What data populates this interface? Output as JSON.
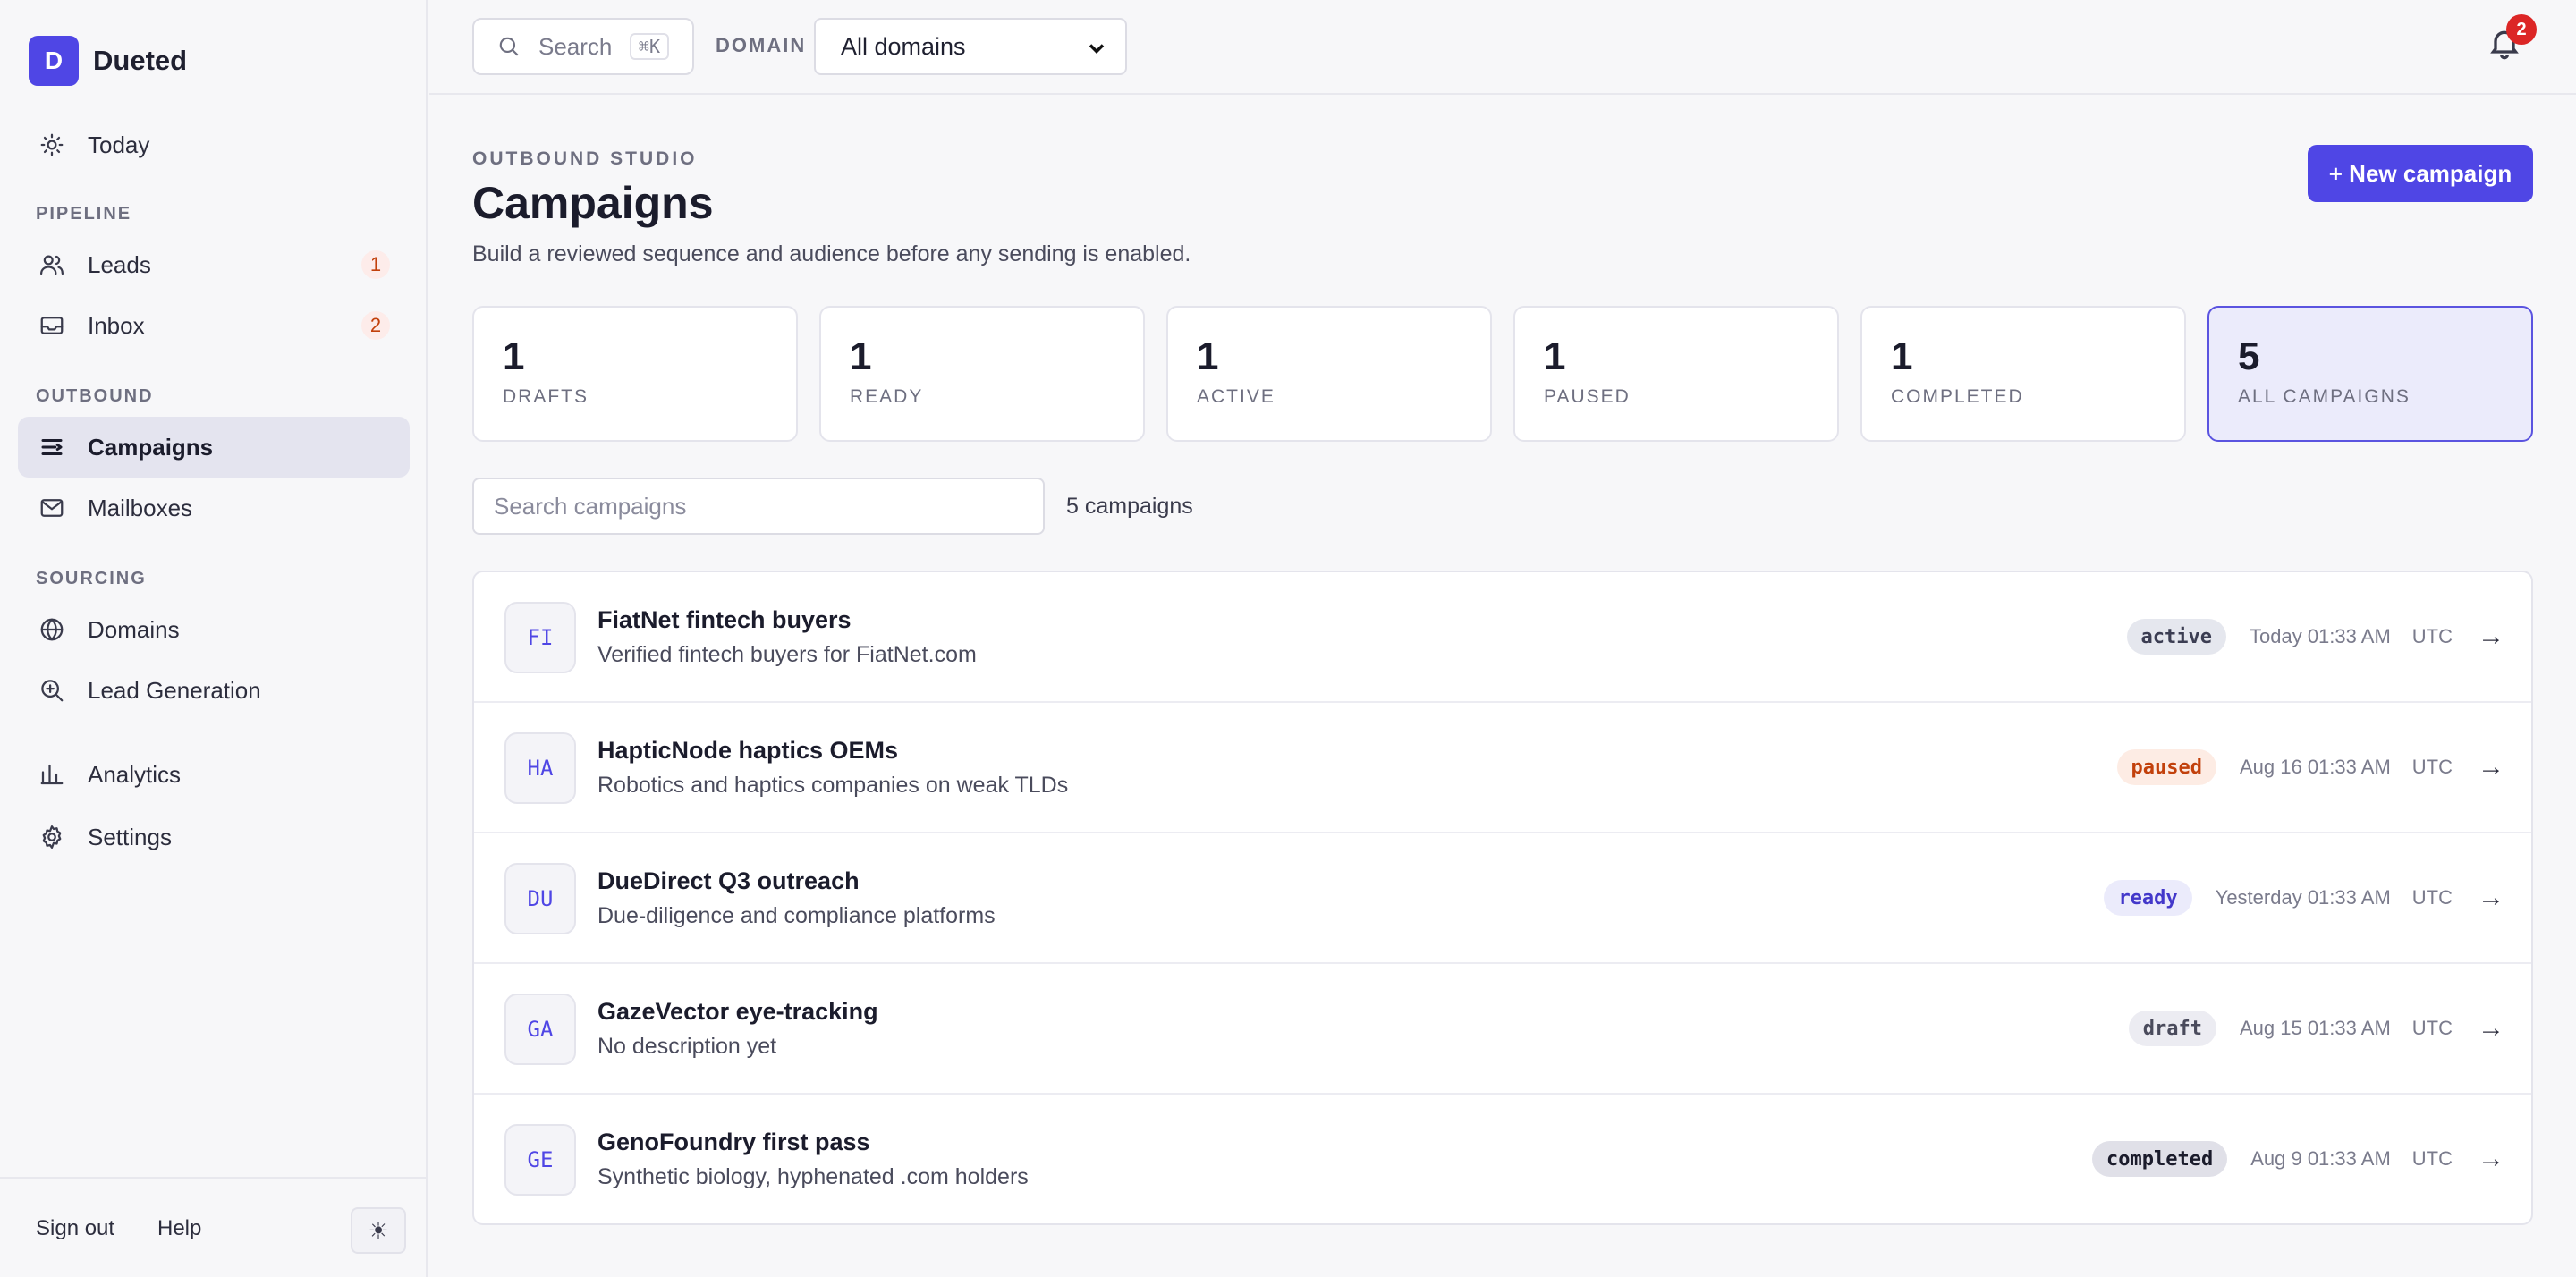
{
  "brand": {
    "initial": "D",
    "name": "Dueted"
  },
  "nav": {
    "today": "Today",
    "pipeline_label": "PIPELINE",
    "leads": {
      "label": "Leads",
      "badge": "1"
    },
    "inbox": {
      "label": "Inbox",
      "badge": "2"
    },
    "outbound_label": "OUTBOUND",
    "campaigns": "Campaigns",
    "mailboxes": "Mailboxes",
    "sourcing_label": "SOURCING",
    "domains": "Domains",
    "lead_generation": "Lead Generation",
    "analytics": "Analytics",
    "settings": "Settings"
  },
  "footer": {
    "sign_out": "Sign out",
    "help": "Help",
    "theme_icon": "☀"
  },
  "topbar": {
    "search_placeholder": "Search",
    "search_shortcut": "⌘K",
    "domain_label": "DOMAIN",
    "domain_value": "All domains",
    "notifications_count": "2"
  },
  "header": {
    "eyebrow": "OUTBOUND STUDIO",
    "title": "Campaigns",
    "subtitle": "Build a reviewed sequence and audience before any sending is enabled.",
    "new_button": "+ New campaign"
  },
  "stats": [
    {
      "value": "1",
      "label": "DRAFTS"
    },
    {
      "value": "1",
      "label": "READY"
    },
    {
      "value": "1",
      "label": "ACTIVE"
    },
    {
      "value": "1",
      "label": "PAUSED"
    },
    {
      "value": "1",
      "label": "COMPLETED"
    },
    {
      "value": "5",
      "label": "ALL CAMPAIGNS"
    }
  ],
  "filter": {
    "search_placeholder": "Search campaigns",
    "count": "5 campaigns"
  },
  "campaigns": [
    {
      "initials": "FI",
      "name": "FiatNet fintech buyers",
      "description": "Verified fintech buyers for FiatNet.com",
      "status": "active",
      "date": "Today 01:33 AM",
      "tz": "UTC",
      "arrow": "→"
    },
    {
      "initials": "HA",
      "name": "HapticNode haptics OEMs",
      "description": "Robotics and haptics companies on weak TLDs",
      "status": "paused",
      "date": "Aug 16 01:33 AM",
      "tz": "UTC",
      "arrow": "→"
    },
    {
      "initials": "DU",
      "name": "DueDirect Q3 outreach",
      "description": "Due-diligence and compliance platforms",
      "status": "ready",
      "date": "Yesterday 01:33 AM",
      "tz": "UTC",
      "arrow": "→"
    },
    {
      "initials": "GA",
      "name": "GazeVector eye-tracking",
      "description": "No description yet",
      "status": "draft",
      "date": "Aug 15 01:33 AM",
      "tz": "UTC",
      "arrow": "→"
    },
    {
      "initials": "GE",
      "name": "GenoFoundry first pass",
      "description": "Synthetic biology, hyphenated .com holders",
      "status": "completed",
      "date": "Aug 9 01:33 AM",
      "tz": "UTC",
      "arrow": "→"
    }
  ],
  "colors": {
    "accent": "#4f46e5",
    "danger": "#dc2626",
    "paused": "#c2410c"
  }
}
